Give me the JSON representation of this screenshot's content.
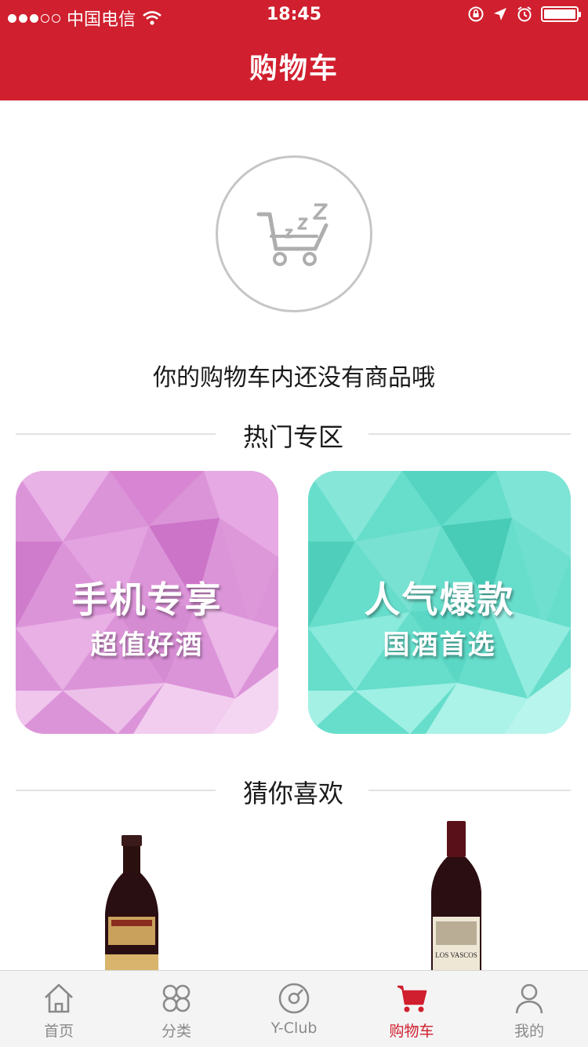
{
  "status_bar": {
    "carrier": "中国电信",
    "time": "18:45"
  },
  "header": {
    "title": "购物车"
  },
  "empty_cart": {
    "icon": "sleeping-cart-icon",
    "message": "你的购物车内还没有商品哦"
  },
  "hot_section": {
    "title": "热门专区",
    "promos": [
      {
        "line1": "手机专享",
        "line2": "超值好酒",
        "color": "#d98fd6"
      },
      {
        "line1": "人气爆款",
        "line2": "国酒首选",
        "color": "#63ddca"
      }
    ]
  },
  "recommend_section": {
    "title": "猜你喜欢",
    "products": [
      {
        "image": "red-wine-bottle-1"
      },
      {
        "image": "red-wine-bottle-2",
        "label": "LOS VASCOS"
      }
    ]
  },
  "tabbar": {
    "items": [
      {
        "label": "首页",
        "icon": "home-icon",
        "active": false
      },
      {
        "label": "分类",
        "icon": "category-icon",
        "active": false
      },
      {
        "label": "Y-Club",
        "icon": "club-icon",
        "active": false
      },
      {
        "label": "购物车",
        "icon": "cart-icon",
        "active": true
      },
      {
        "label": "我的",
        "icon": "user-icon",
        "active": false
      }
    ]
  },
  "colors": {
    "brand_red": "#d01f2e",
    "pink_tile": "#d98fd6",
    "teal_tile": "#63ddca"
  }
}
